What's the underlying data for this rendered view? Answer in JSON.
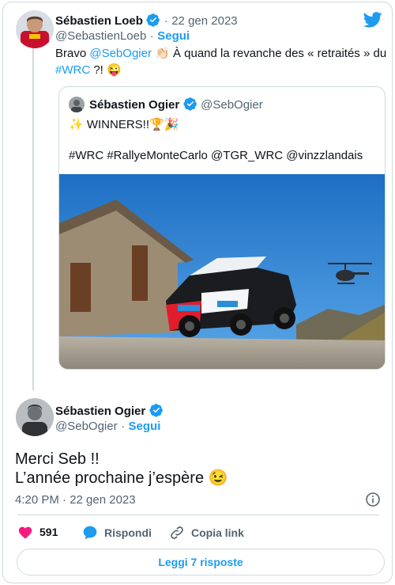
{
  "tweet": {
    "author_name": "Sébastien Loeb",
    "dot": "·",
    "date": "22 gen 2023",
    "handle": "@SebastienLoeb",
    "follow_label": "Segui",
    "text_part1": "Bravo ",
    "mention": "@SebOgier",
    "text_part2": " 👏🏻 À quand la revanche des « retraités » du",
    "hashtag": "#WRC",
    "text_part3": " ?! 😜"
  },
  "quoted": {
    "author_name": "Sébastien Ogier",
    "handle": "@SebOgier",
    "line1": "✨ WINNERS!!🏆🎉",
    "line2": "#WRC #RallyeMonteCarlo @TGR_WRC @vinzzlandais"
  },
  "reply": {
    "author_name": "Sébastien Ogier",
    "handle": "@SebOgier",
    "dot": "·",
    "follow_label": "Segui",
    "line1": "Merci Seb !!",
    "line2": "L’année prochaine j’espère 😉",
    "timestamp": "4:20 PM · 22 gen 2023"
  },
  "actions": {
    "likes": "591",
    "reply_label": "Rispondi",
    "copy_label": "Copia link"
  },
  "footer": {
    "more_replies_label": "Leggi 7 risposte"
  },
  "colors": {
    "accent": "#1d9bf0",
    "like": "#f91880",
    "muted": "#536471",
    "border": "#cfd9de"
  }
}
